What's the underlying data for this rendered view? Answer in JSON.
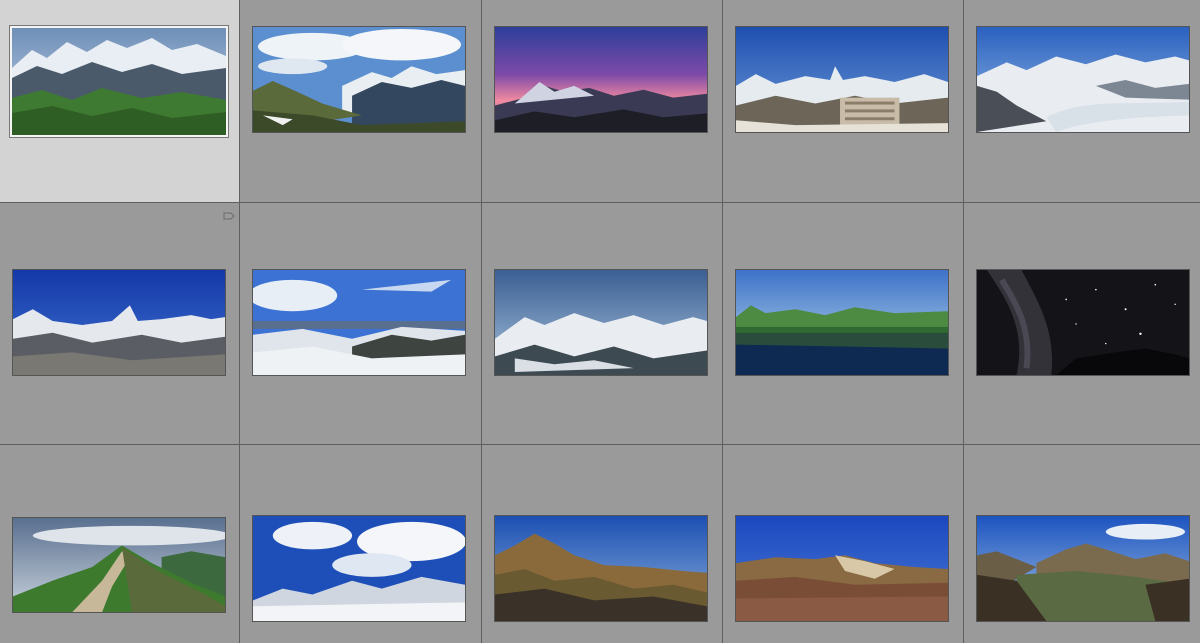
{
  "grid": {
    "background": "#9a9a9a",
    "selected_background": "#d3d3d3",
    "columns": 5,
    "rows": 3
  },
  "thumbnails": [
    {
      "name": "swiss-alps-green-valley",
      "selected": true
    },
    {
      "name": "alpine-ridge-clouds"
    },
    {
      "name": "mountain-sunset-pink-sky"
    },
    {
      "name": "matterhorn-hotel"
    },
    {
      "name": "glacier-panorama"
    },
    {
      "name": "matterhorn-blue-sky",
      "badge_icon": "flag-icon"
    },
    {
      "name": "snowy-forest-clouds"
    },
    {
      "name": "snowy-peaks-blue-dusk"
    },
    {
      "name": "lake-reflection-mountains"
    },
    {
      "name": "milky-way-night-sky"
    },
    {
      "name": "mountain-trail-ridge"
    },
    {
      "name": "snowfield-big-clouds"
    },
    {
      "name": "rocky-brown-mountain"
    },
    {
      "name": "volcanic-crater-rim"
    },
    {
      "name": "volcano-valley-panorama"
    }
  ]
}
